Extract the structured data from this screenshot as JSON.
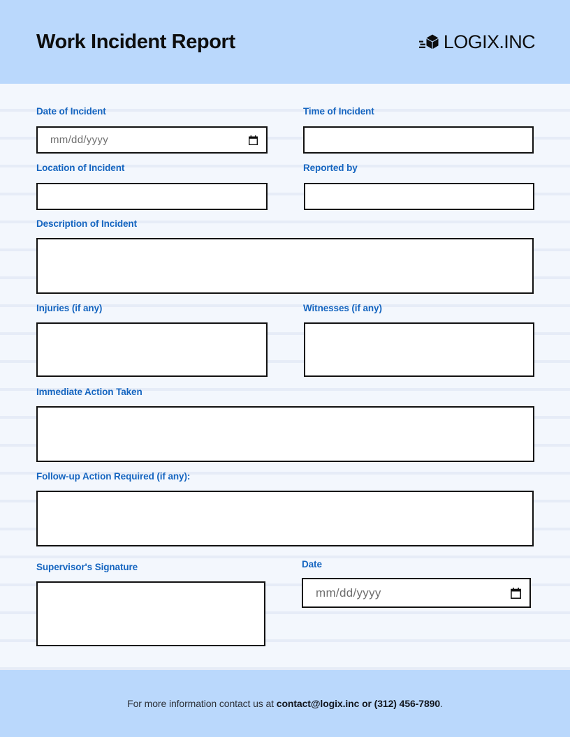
{
  "header": {
    "title": "Work Incident Report",
    "brand_name": "LOGIX.INC",
    "brand_icon": "cube-box-icon",
    "background_color": "#bad8fc"
  },
  "theme": {
    "label_color": "#1565c0",
    "band_color": "#bad8fc",
    "page_background": "#f3f7fd",
    "stripe_color": "#e6ecf7",
    "input_border": "#111111"
  },
  "form": {
    "fields": [
      {
        "id": "date-of-incident",
        "label": "Date of Incident",
        "type": "date",
        "value": "",
        "placeholder": "mm/dd/yyyy",
        "icon": "calendar-icon"
      },
      {
        "id": "time-of-incident",
        "label": "Time of Incident",
        "type": "text",
        "value": "",
        "placeholder": ""
      },
      {
        "id": "location-of-incident",
        "label": "Location of Incident",
        "type": "text",
        "value": "",
        "placeholder": ""
      },
      {
        "id": "reported-by",
        "label": "Reported by",
        "type": "text",
        "value": "",
        "placeholder": ""
      },
      {
        "id": "description-of-incident",
        "label": "Description of Incident",
        "type": "textarea",
        "value": "",
        "placeholder": ""
      },
      {
        "id": "injuries",
        "label": "Injuries (if any)",
        "type": "textarea",
        "value": "",
        "placeholder": ""
      },
      {
        "id": "witnesses",
        "label": "Witnesses (if any)",
        "type": "textarea",
        "value": "",
        "placeholder": ""
      },
      {
        "id": "immediate-action-taken",
        "label": "Immediate Action Taken",
        "type": "textarea",
        "value": "",
        "placeholder": ""
      },
      {
        "id": "follow-up-action-required",
        "label": "Follow-up Action Required (if any):",
        "type": "textarea",
        "value": "",
        "placeholder": ""
      },
      {
        "id": "supervisors-signature",
        "label": "Supervisor's Signature",
        "type": "signature",
        "value": "",
        "placeholder": ""
      },
      {
        "id": "signature-date",
        "label": "Date",
        "type": "date",
        "value": "",
        "placeholder": "mm/dd/yyyy",
        "icon": "calendar-icon"
      }
    ]
  },
  "footer": {
    "text_before": "For more information contact us at ",
    "contact_bold": "contact@logix.inc or (312) 456-7890",
    "text_after": "."
  }
}
